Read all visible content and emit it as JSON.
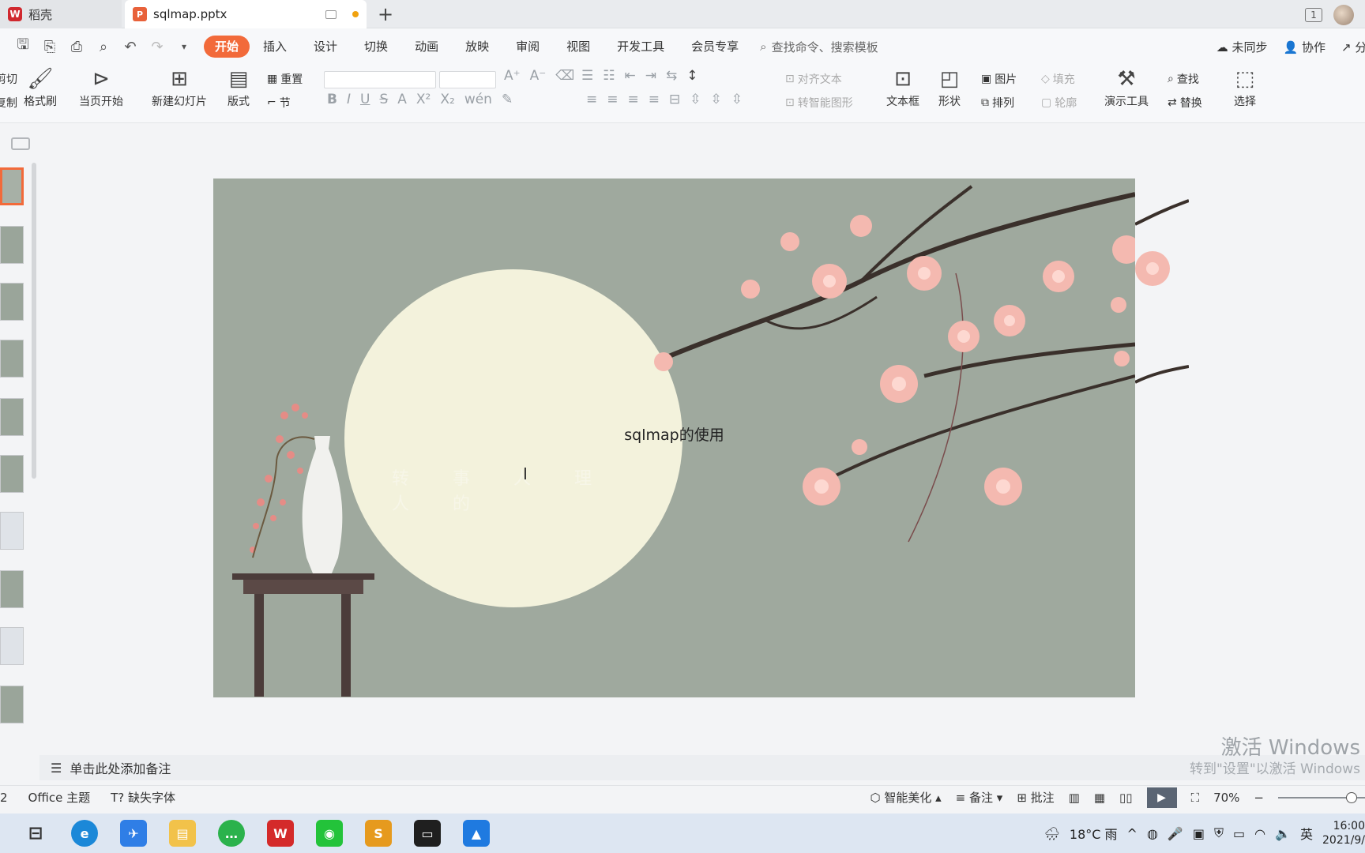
{
  "tabs": [
    {
      "label": "稻壳"
    },
    {
      "label": "sqlmap.pptx"
    }
  ],
  "window": {
    "badge": "1"
  },
  "menu": {
    "items": [
      "开始",
      "插入",
      "设计",
      "切换",
      "动画",
      "放映",
      "审阅",
      "视图",
      "开发工具",
      "会员专享"
    ],
    "search_placeholder": "查找命令、搜索模板",
    "right": [
      "未同步",
      "协作",
      "分享"
    ]
  },
  "ribbon": {
    "cut": "剪切",
    "copy": "复制",
    "format_painter": "格式刷",
    "from_current": "当页开始",
    "new_slide": "新建幻灯片",
    "layout": "版式",
    "reset": "重置",
    "section": "节",
    "align_text": "对齐文本",
    "to_smartart": "转智能图形",
    "textbox": "文本框",
    "shape": "形状",
    "picture": "图片",
    "arrange": "排列",
    "fill": "填充",
    "outline": "轮廓",
    "present_tools": "演示工具",
    "find": "查找",
    "replace": "替换",
    "select": "选择"
  },
  "slide": {
    "title": "sqlmap的使用",
    "subtitle": "转 事 人 理 人 的"
  },
  "notes": {
    "placeholder": "单击此处添加备注"
  },
  "watermark": {
    "line1": "激活 Windows",
    "line2": "转到\"设置\"以激活 Windows"
  },
  "status": {
    "slide_num": "2",
    "theme": "Office 主题",
    "missing_font": "缺失字体",
    "beautify": "智能美化",
    "notes": "备注",
    "comments": "批注",
    "zoom": "70%"
  },
  "taskbar": {
    "weather": "18°C 雨",
    "ime": "英",
    "time": "16:00",
    "date": "2021/9/"
  },
  "colors": {
    "accent": "#f26a3a",
    "slide_bg": "#9fa99e",
    "moon": "#f3f2dc"
  }
}
